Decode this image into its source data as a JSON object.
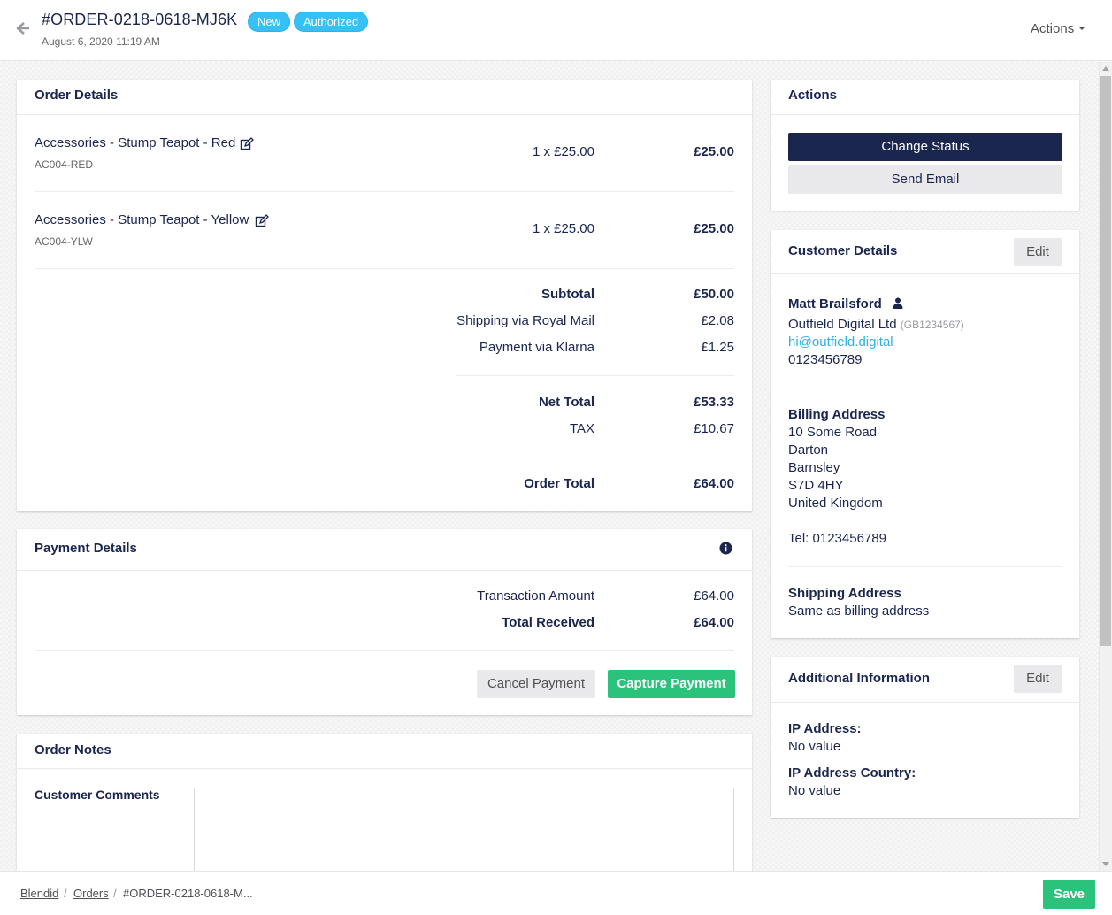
{
  "header": {
    "order_number": "#ORDER-0218-0618-MJ6K",
    "badges": [
      "New",
      "Authorized"
    ],
    "date": "August 6, 2020 11:19 AM",
    "actions_label": "Actions",
    "badge_color": "#35c1f6"
  },
  "order_details": {
    "title": "Order Details",
    "items": [
      {
        "name": "Accessories - Stump Teapot - Red",
        "sku": "AC004-RED",
        "qty": "1 x £25.00",
        "total": "£25.00"
      },
      {
        "name": "Accessories - Stump Teapot - Yellow",
        "sku": "AC004-YLW",
        "qty": "1 x £25.00",
        "total": "£25.00"
      }
    ],
    "subtotal_label": "Subtotal",
    "subtotal": "£50.00",
    "shipping_label": "Shipping via Royal Mail",
    "shipping": "£2.08",
    "payment_label": "Payment via Klarna",
    "payment": "£1.25",
    "net_total_label": "Net Total",
    "net_total": "£53.33",
    "tax_label": "TAX",
    "tax": "£10.67",
    "order_total_label": "Order Total",
    "order_total": "£64.00"
  },
  "payment_details": {
    "title": "Payment Details",
    "transaction_label": "Transaction Amount",
    "transaction": "£64.00",
    "received_label": "Total Received",
    "received": "£64.00",
    "cancel_label": "Cancel Payment",
    "capture_label": "Capture Payment"
  },
  "order_notes": {
    "title": "Order Notes",
    "customer_comments_label": "Customer Comments",
    "customer_comments": ""
  },
  "actions_panel": {
    "title": "Actions",
    "change_status_label": "Change Status",
    "send_email_label": "Send Email"
  },
  "customer_details": {
    "title": "Customer Details",
    "edit_label": "Edit",
    "name": "Matt Brailsford",
    "company": "Outfield Digital Ltd",
    "tax_code": "(GB1234567)",
    "email": "hi@outfield.digital",
    "phone": "0123456789",
    "billing_title": "Billing Address",
    "billing_lines": [
      "10 Some Road",
      "Darton",
      "Barnsley",
      "S7D 4HY",
      "United Kingdom"
    ],
    "billing_tel": "Tel: 0123456789",
    "shipping_title": "Shipping Address",
    "shipping_text": "Same as billing address"
  },
  "additional_info": {
    "title": "Additional Information",
    "edit_label": "Edit",
    "ip_label": "IP Address:",
    "ip_value": "No value",
    "ip_country_label": "IP Address Country:",
    "ip_country_value": "No value"
  },
  "footer": {
    "breadcrumbs": [
      "Blendid",
      "Orders",
      "#ORDER-0218-0618-M..."
    ],
    "save_label": "Save"
  },
  "colors": {
    "navy": "#1b264f",
    "green": "#2bc37c",
    "light_blue": "#35c1f6"
  }
}
